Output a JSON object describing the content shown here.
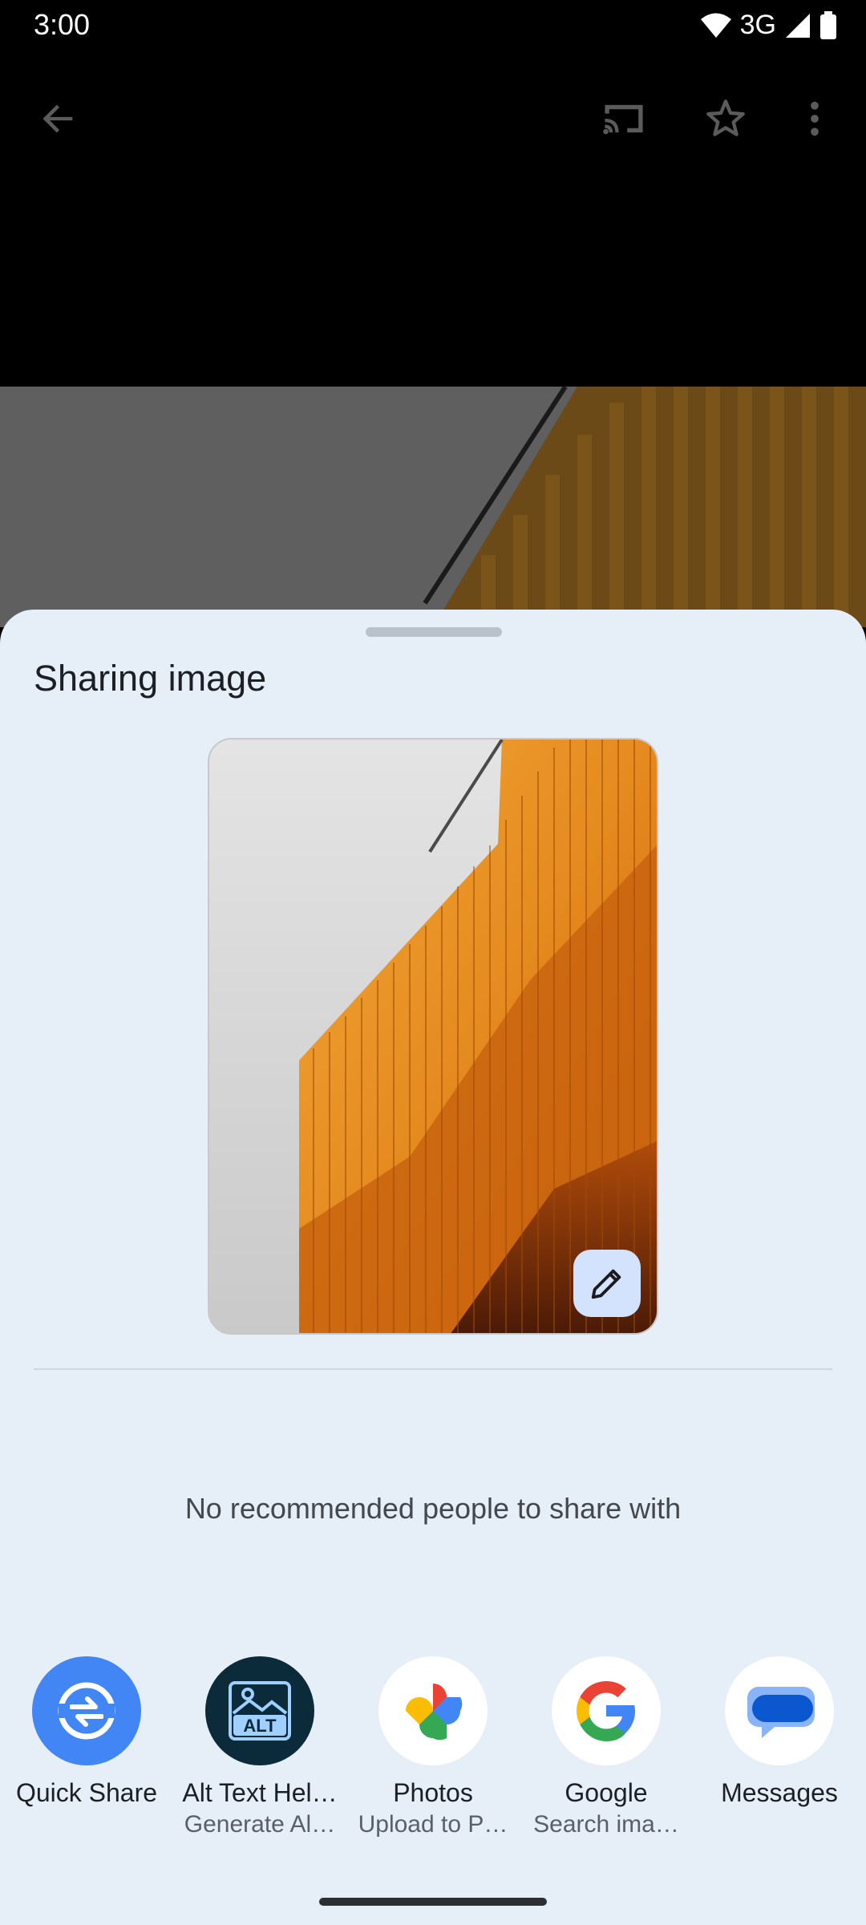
{
  "status_bar": {
    "time": "3:00",
    "network": "3G",
    "icons": [
      "wifi-icon",
      "cellular-signal-icon",
      "battery-icon"
    ]
  },
  "app_bar": {
    "icons": [
      "back-arrow-icon",
      "cast-icon",
      "star-icon",
      "more-vert-icon"
    ]
  },
  "share_sheet": {
    "title": "Sharing image",
    "edit_icon": "pencil-icon",
    "no_recommendations": "No recommended people to share with",
    "targets": [
      {
        "label": "Quick Share",
        "subtitle": "",
        "icon": "quick-share-icon",
        "color": "#4285f4"
      },
      {
        "label": "Alt Text Hel…",
        "subtitle": "Generate Al…",
        "icon": "alt-text-icon",
        "color": "#0b2a3a"
      },
      {
        "label": "Photos",
        "subtitle": "Upload to P…",
        "icon": "photos-pinwheel-icon",
        "color": "#ffffff"
      },
      {
        "label": "Google",
        "subtitle": "Search ima…",
        "icon": "google-g-icon",
        "color": "#ffffff"
      },
      {
        "label": "Messages",
        "subtitle": "",
        "icon": "messages-icon",
        "color": "#ffffff"
      }
    ]
  },
  "colors": {
    "sheet_background": "#e6eef8",
    "accent_blue": "#4285f4",
    "facade_orange": "#e0861c"
  }
}
